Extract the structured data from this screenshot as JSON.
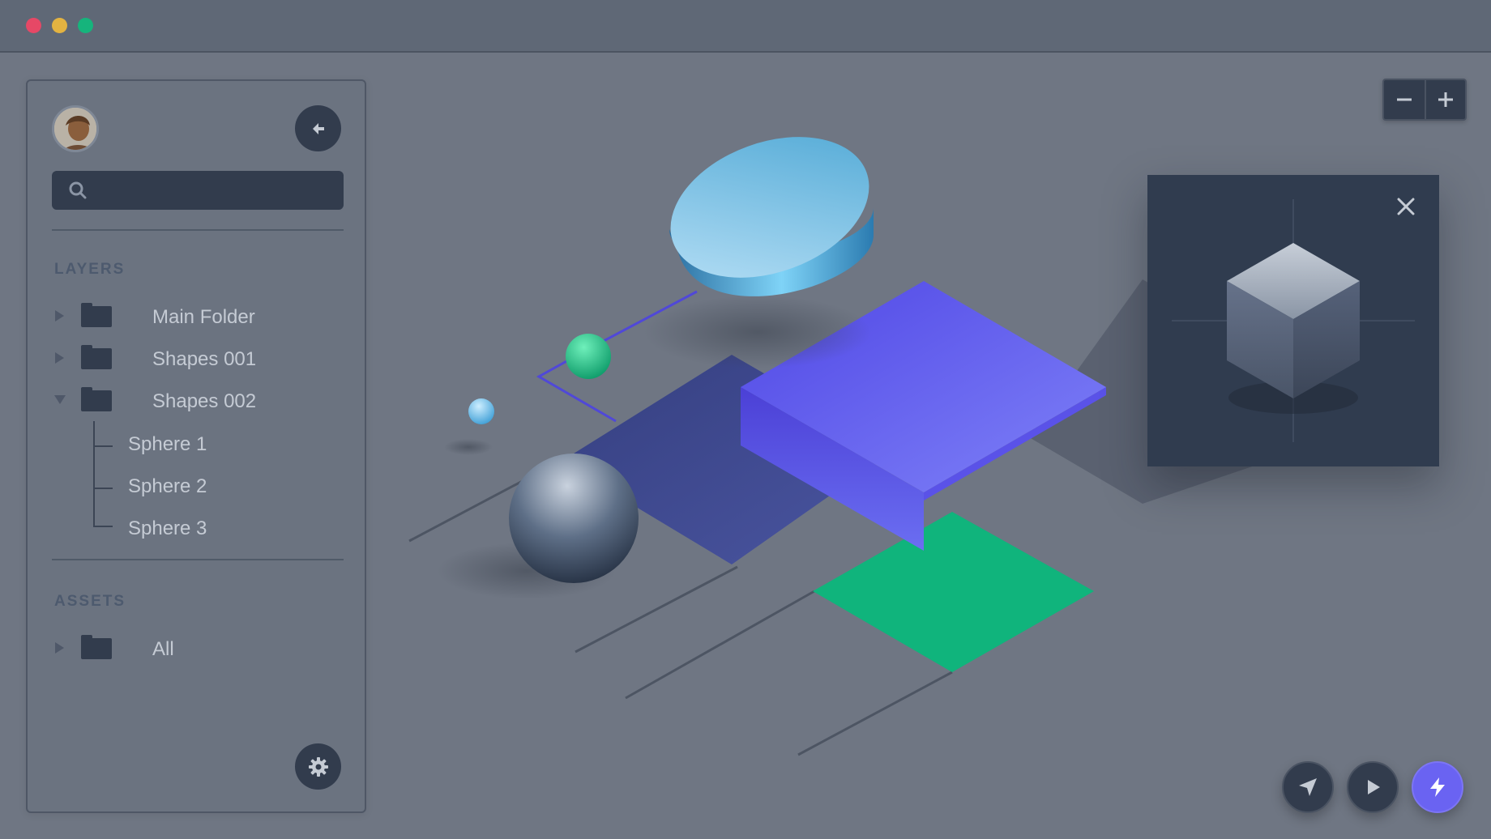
{
  "window": {
    "controls": [
      "close",
      "minimize",
      "maximize"
    ]
  },
  "sidebar": {
    "avatar_icon": "user-avatar",
    "back_icon": "arrow-left-icon",
    "search": {
      "placeholder": "",
      "icon": "search-icon"
    },
    "layers": {
      "title": "LAYERS",
      "items": [
        {
          "label": "Main Folder",
          "state": "collapsed",
          "icon": "folder-icon"
        },
        {
          "label": "Shapes 001",
          "state": "collapsed",
          "icon": "folder-icon"
        },
        {
          "label": "Shapes 002",
          "state": "expanded",
          "icon": "folder-icon",
          "children": [
            "Sphere 1",
            "Sphere 2",
            "Sphere 3"
          ]
        }
      ]
    },
    "assets": {
      "title": "ASSETS",
      "items": [
        {
          "label": "All",
          "state": "collapsed",
          "icon": "folder-icon"
        }
      ]
    },
    "settings_icon": "gear-icon"
  },
  "zoom": {
    "minus_icon": "minus-icon",
    "plus_icon": "plus-icon"
  },
  "inspector": {
    "close_icon": "close-icon",
    "preview": "cube"
  },
  "toolbar": {
    "buttons": [
      "send-icon",
      "play-icon",
      "lightning-icon"
    ]
  },
  "colors": {
    "accent": "#6a63f2",
    "green": "#10b47c",
    "panel_dark": "#323c4d",
    "canvas": "#6f7683"
  }
}
